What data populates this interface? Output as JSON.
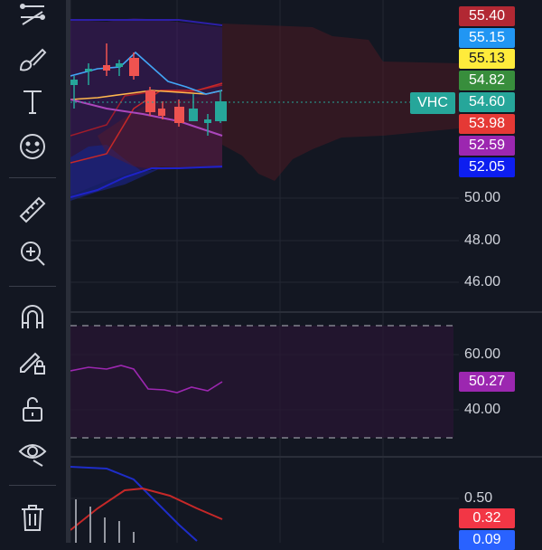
{
  "toolbar": {
    "tools": [
      {
        "name": "trend-lines-icon"
      },
      {
        "name": "brush-icon"
      },
      {
        "name": "text-icon"
      },
      {
        "name": "emoji-icon"
      },
      {
        "name": "ruler-icon"
      },
      {
        "name": "zoom-in-icon"
      },
      {
        "name": "magnet-icon"
      },
      {
        "name": "lock-drawings-icon"
      },
      {
        "name": "unlock-icon"
      },
      {
        "name": "eye-icon"
      },
      {
        "name": "trash-icon"
      }
    ]
  },
  "price_labels": [
    {
      "text": "55.40",
      "bg": "#b22833",
      "fg": "#ffffff"
    },
    {
      "text": "55.15",
      "bg": "#2196f3",
      "fg": "#ffffff"
    },
    {
      "text": "55.13",
      "bg": "#ffeb3b",
      "fg": "#131722"
    },
    {
      "text": "54.82",
      "bg": "#388e3c",
      "fg": "#ffffff"
    },
    {
      "text": "54.60",
      "bg": "#26a69a",
      "fg": "#ffffff"
    },
    {
      "text": "53.98",
      "bg": "#e53935",
      "fg": "#ffffff"
    },
    {
      "text": "52.59",
      "bg": "#9c27b0",
      "fg": "#ffffff"
    },
    {
      "text": "52.05",
      "bg": "#0d1ef0",
      "fg": "#ffffff"
    }
  ],
  "symbol_label": "VHC",
  "price_axis": [
    "50.00",
    "48.00",
    "46.00"
  ],
  "rsi": {
    "axis": [
      "60.00",
      "40.00"
    ],
    "value": "50.27",
    "value_bg": "#9c27b0"
  },
  "macd": {
    "axis": [
      "0.50"
    ],
    "signal": "0.32",
    "signal_bg": "#f23645",
    "macd_value": "0.09",
    "macd_bg": "#2962ff"
  },
  "colors": {
    "background": "#131722",
    "bullish": "#26a69a",
    "bearish": "#ef5350",
    "rsi_line": "#9c27b0",
    "ma_line": "#ffb74d"
  }
}
